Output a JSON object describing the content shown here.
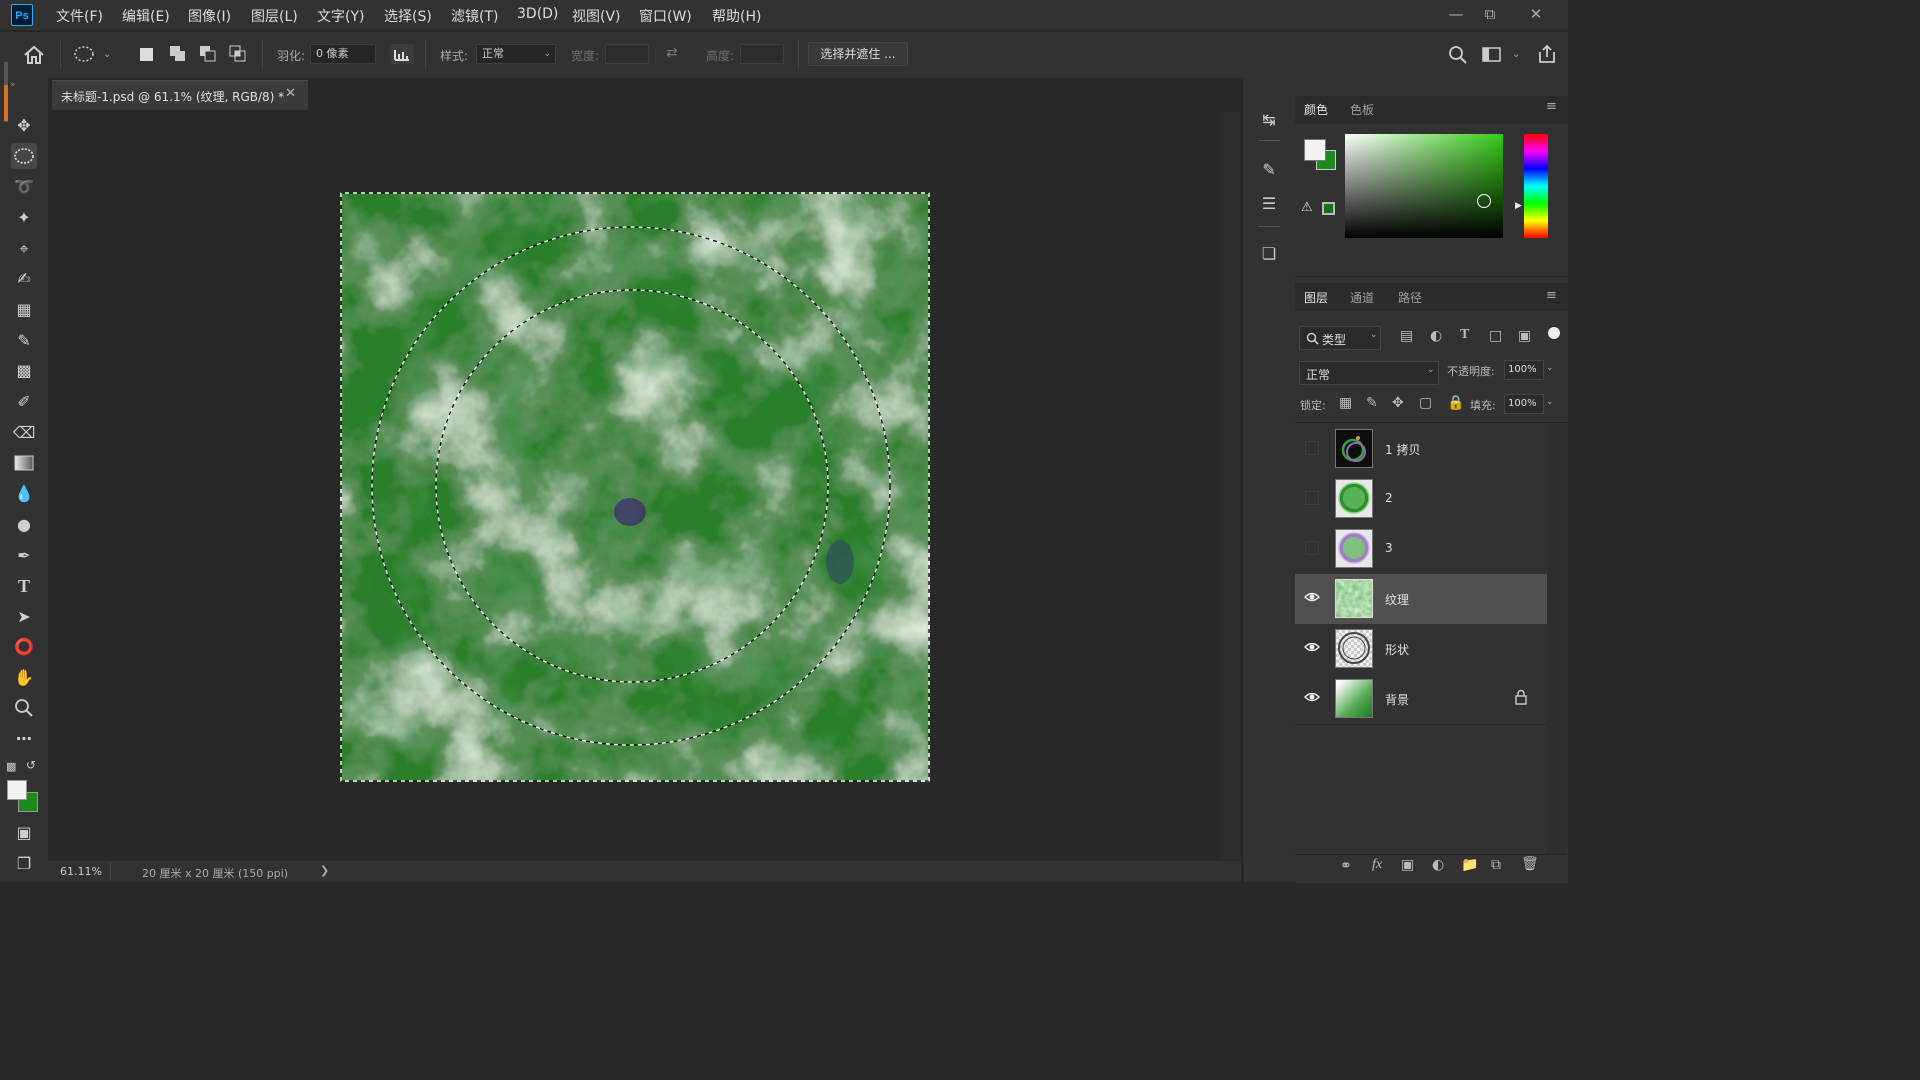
{
  "app": {
    "logo": "Ps"
  },
  "menu": [
    "文件(F)",
    "编辑(E)",
    "图像(I)",
    "图层(L)",
    "文字(Y)",
    "选择(S)",
    "滤镜(T)",
    "3D(D)",
    "视图(V)",
    "窗口(W)",
    "帮助(H)"
  ],
  "window_controls": [
    "minimize-icon",
    "restore-icon",
    "close-icon"
  ],
  "options": {
    "feather_label": "羽化:",
    "feather_value": "0 像素",
    "style_label": "样式:",
    "style_value": "正常",
    "width_label": "宽度:",
    "height_label": "高度:",
    "select_mask_button": "选择并遮住 ..."
  },
  "document": {
    "tab_title": "未标题-1.psd @ 61.1% (纹理, RGB/8) *",
    "zoom": "61.11%",
    "doc_info": "20 厘米 x 20 厘米 (150 ppi)"
  },
  "color_panel": {
    "tabs": [
      "颜色",
      "色板"
    ],
    "foreground": "#f2f2f2",
    "background": "#1e8a1e"
  },
  "layers_panel": {
    "tabs": [
      "图层",
      "通道",
      "路径"
    ],
    "filter_kind": "类型",
    "blend_mode": "正常",
    "opacity_label": "不透明度:",
    "opacity_value": "100%",
    "lock_label": "锁定:",
    "fill_label": "填充:",
    "fill_value": "100%",
    "layers": [
      {
        "name": "1 拷贝",
        "visible": false,
        "selected": false,
        "locked": false
      },
      {
        "name": "2",
        "visible": false,
        "selected": false,
        "locked": false
      },
      {
        "name": "3",
        "visible": false,
        "selected": false,
        "locked": false
      },
      {
        "name": "纹理",
        "visible": true,
        "selected": true,
        "locked": false
      },
      {
        "name": "形状",
        "visible": true,
        "selected": false,
        "locked": false
      },
      {
        "name": "背景",
        "visible": true,
        "selected": false,
        "locked": true
      }
    ]
  },
  "colors": {
    "accent_green": "#2f8f2f",
    "dark_green": "#1a6b1a",
    "texture_light": "#e8f3e6"
  }
}
